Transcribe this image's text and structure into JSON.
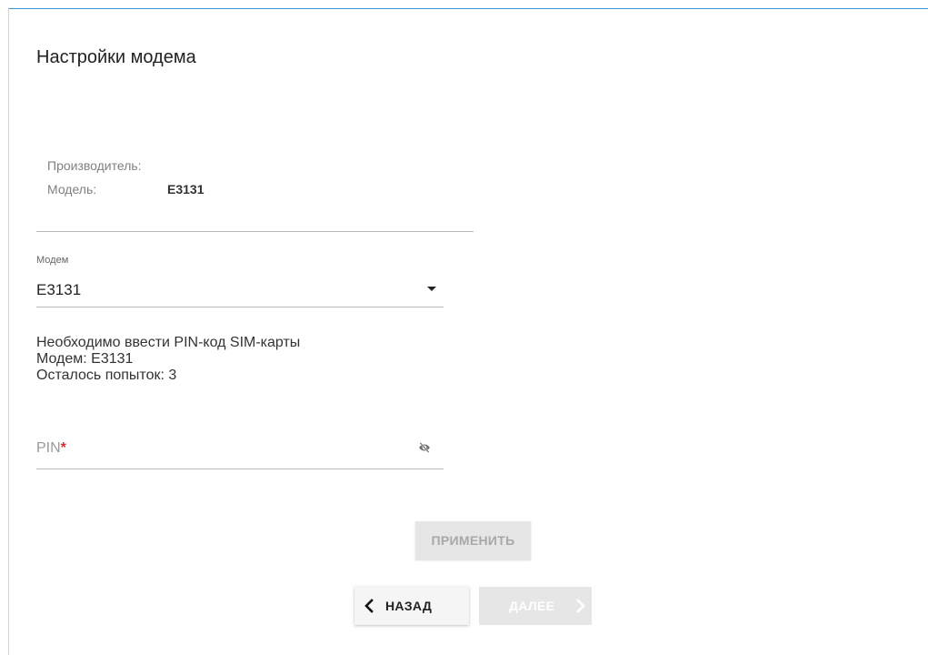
{
  "page": {
    "title": "Настройки модема"
  },
  "modem_info": {
    "manufacturer_label": "Производитель:",
    "manufacturer_value": "",
    "model_label": "Модель:",
    "model_value": "E3131"
  },
  "modem_select": {
    "label": "Модем",
    "selected": "E3131"
  },
  "message": {
    "line1": "Необходимо ввести PIN-код SIM-карты",
    "line2": "Модем: E3131",
    "line3": "Осталось попыток: 3"
  },
  "pin_field": {
    "label": "PIN",
    "required_mark": "*",
    "value": ""
  },
  "buttons": {
    "apply": "ПРИМЕНИТЬ",
    "back": "НАЗАД",
    "next": "ДАЛЕЕ"
  },
  "icons": {
    "select_caret": "caret-down-icon",
    "pin_visibility": "eye-off-icon",
    "back": "chevron-left-icon",
    "next": "chevron-right-icon"
  },
  "colors": {
    "top_accent": "#3a9bd5",
    "required_mark": "#d32f2f",
    "disabled_button_bg": "#e6e6e6",
    "disabled_button_text": "#a8a8a8"
  }
}
